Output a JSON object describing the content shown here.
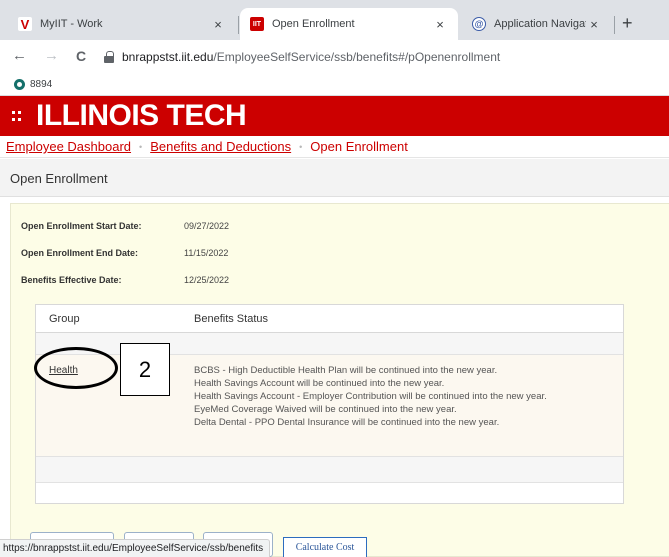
{
  "browser": {
    "tabs": [
      {
        "title": "MyIIT - Work",
        "close": "×"
      },
      {
        "title": "Open Enrollment",
        "close": "×"
      },
      {
        "title": "Application Navigator",
        "close": "×"
      }
    ],
    "new_tab": "+",
    "nav": {
      "back": "←",
      "forward": "→",
      "reload": "C"
    },
    "url_host": "bnrappstst.iit.edu",
    "url_path": "/EmployeeSelfService/ssb/benefits#/pOpenenrollment",
    "bookmark": "8894"
  },
  "header": {
    "brand": "ILLINOIS TECH"
  },
  "breadcrumb": {
    "items": [
      "Employee Dashboard",
      "Benefits and Deductions",
      "Open Enrollment"
    ],
    "separator": "•"
  },
  "page": {
    "title": "Open Enrollment"
  },
  "enrollment": {
    "start_label": "Open Enrollment Start Date:",
    "start_value": "09/27/2022",
    "end_label": "Open Enrollment End Date:",
    "end_value": "11/15/2022",
    "effective_label": "Benefits Effective Date:",
    "effective_value": "12/25/2022"
  },
  "table": {
    "headers": [
      "Group",
      "Benefits Status"
    ],
    "rows": [
      {
        "group": "Health",
        "status": [
          "BCBS - High Deductible Health Plan will be continued into the new year.",
          "Health Savings Account will be continued into the new year.",
          "Health Savings Account - Employer Contribution will be continued into the new year.",
          "EyeMed Coverage Waived will be continued into the new year.",
          "Delta Dental - PPO Dental Insurance will be continued into the new year."
        ]
      }
    ]
  },
  "annotation": {
    "step": "2"
  },
  "status_url": "https://bnrappstst.iit.edu/EmployeeSelfService/ssb/benefits",
  "actions": {
    "calculate_cost": "Calculate Cost"
  }
}
